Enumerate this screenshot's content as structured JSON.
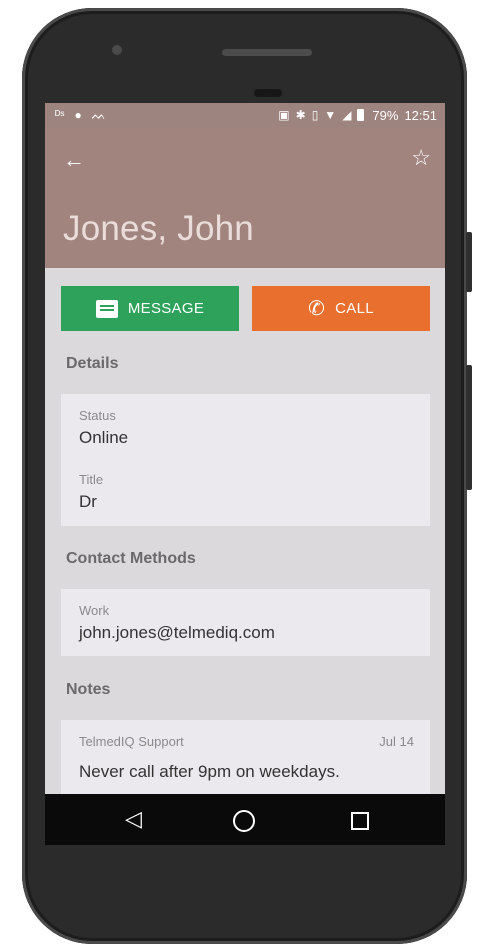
{
  "status_bar": {
    "left_icons": [
      "ds-icon",
      "android-icon",
      "mood-icon"
    ],
    "battery": "79%",
    "time": "12:51"
  },
  "app_bar": {
    "name": "Jones, John"
  },
  "actions": {
    "message_label": "MESSAGE",
    "call_label": "CALL"
  },
  "details": {
    "section_title": "Details",
    "fields": [
      {
        "label": "Status",
        "value": "Online"
      },
      {
        "label": "Title",
        "value": "Dr"
      }
    ]
  },
  "contact_methods": {
    "section_title": "Contact Methods",
    "items": [
      {
        "label": "Work",
        "value": "john.jones@telmediq.com"
      }
    ]
  },
  "notes": {
    "section_title": "Notes",
    "items": [
      {
        "author": "TelmedIQ Support",
        "date": "Jul 14",
        "text": "Never call after 9pm on weekdays."
      }
    ]
  },
  "colors": {
    "app_bar": "#a2847f",
    "message_button": "#2ea15a",
    "call_button": "#e86f2e",
    "background": "#dcd9dd"
  }
}
